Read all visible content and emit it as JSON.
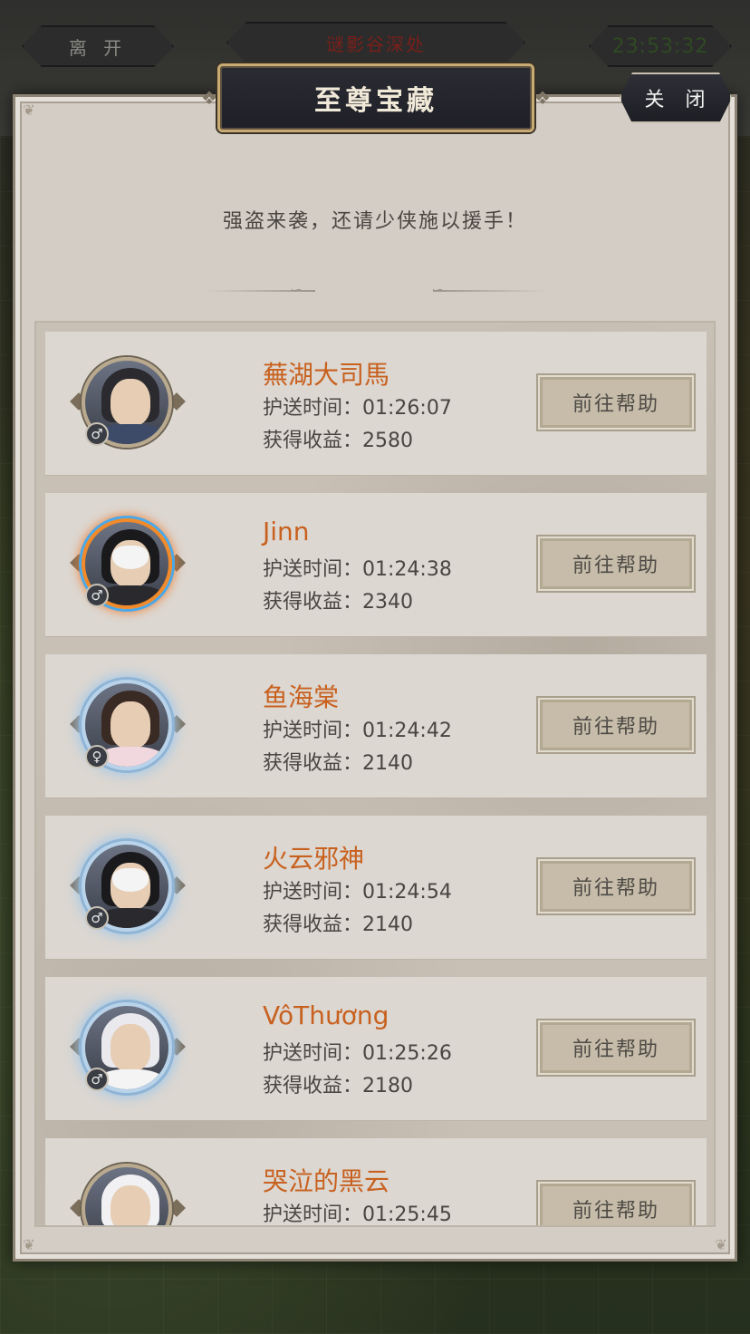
{
  "hud": {
    "leave_label": "离 开",
    "location": "谜影谷深处",
    "clock": "23:53:32"
  },
  "dialog": {
    "title": "至尊宝藏",
    "close_label": "关 闭",
    "subtitle": "强盗来袭，还请少侠施以援手！",
    "time_prefix": "护送时间：",
    "earn_prefix": "获得收益：",
    "help_label": "前往帮助"
  },
  "escorts": [
    {
      "name": "蕪湖大司馬",
      "time": "01:26:07",
      "earnings": "2580",
      "gender": "♂",
      "frame": "gold"
    },
    {
      "name": "Jinn",
      "time": "01:24:38",
      "earnings": "2340",
      "gender": "♂",
      "frame": "fire"
    },
    {
      "name": "鱼海棠",
      "time": "01:24:42",
      "earnings": "2140",
      "gender": "♀",
      "frame": "ice"
    },
    {
      "name": "火云邪神",
      "time": "01:24:54",
      "earnings": "2140",
      "gender": "♂",
      "frame": "ice"
    },
    {
      "name": "VôThương",
      "time": "01:25:26",
      "earnings": "2180",
      "gender": "♂",
      "frame": "ice"
    },
    {
      "name": "哭泣的黑云",
      "time": "01:25:45",
      "earnings": "",
      "gender": "",
      "frame": "gold"
    }
  ],
  "colors": {
    "name_accent": "#c8611f",
    "panel_bg": "#d3cdc6",
    "title_plate": "#1f2027",
    "button_bg": "#c6bca9"
  }
}
